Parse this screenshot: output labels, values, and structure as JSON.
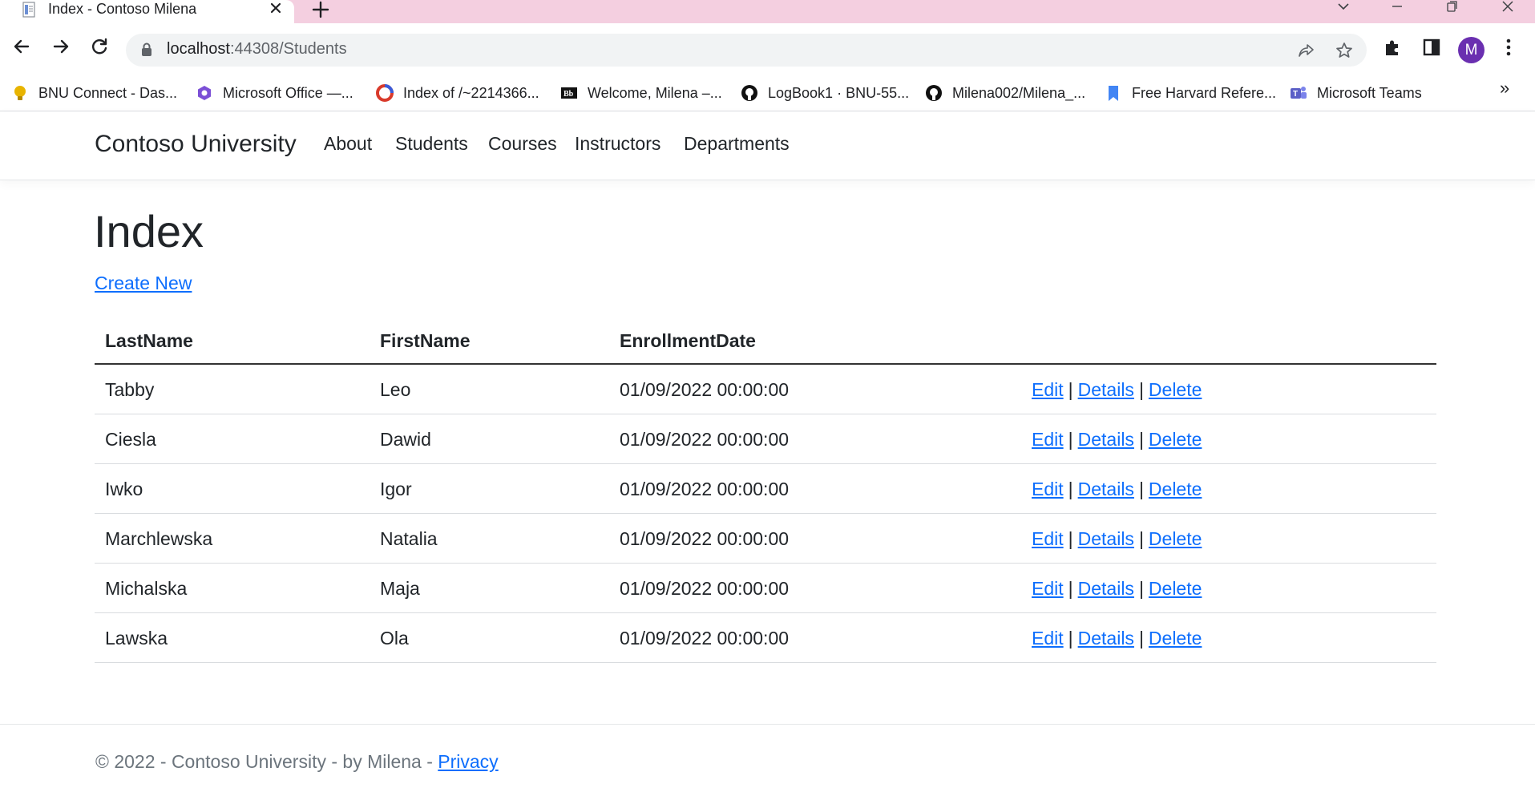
{
  "browser": {
    "tab_title": "Index - Contoso Milena",
    "url_host": "localhost",
    "url_path": ":44308/Students",
    "avatar_letter": "M",
    "accent_tabstrip": "#f4cfe0",
    "bookmarks": [
      {
        "label": "BNU Connect - Das...",
        "icon": "bulb-icon",
        "color": "#e8b400"
      },
      {
        "label": "Microsoft Office —...",
        "icon": "office-icon",
        "color": "#7b4fd6"
      },
      {
        "label": "Index of /~2214366...",
        "icon": "circle-logo-icon",
        "color": "#d93a2b"
      },
      {
        "label": "Welcome, Milena –...",
        "icon": "blackboard-icon",
        "color": "#000000"
      },
      {
        "label": "LogBook1 · BNU-55...",
        "icon": "github-icon",
        "color": "#111111"
      },
      {
        "label": "Milena002/Milena_...",
        "icon": "github-icon",
        "color": "#111111"
      },
      {
        "label": "Free Harvard Refere...",
        "icon": "bookmark-icon",
        "color": "#4285f4"
      },
      {
        "label": "Microsoft Teams",
        "icon": "teams-icon",
        "color": "#5b5fc7"
      }
    ],
    "bookmarks_overflow": "»"
  },
  "site": {
    "brand": "Contoso University",
    "nav": [
      "About",
      "Students",
      "Courses",
      "Instructors",
      "Departments"
    ]
  },
  "main": {
    "title": "Index",
    "create_link": "Create New",
    "columns": [
      "LastName",
      "FirstName",
      "EnrollmentDate"
    ],
    "actions": {
      "edit": "Edit",
      "details": "Details",
      "delete": "Delete",
      "separator": "|"
    },
    "rows": [
      {
        "last": "Tabby",
        "first": "Leo",
        "date": "01/09/2022 00:00:00"
      },
      {
        "last": "Ciesla",
        "first": "Dawid",
        "date": "01/09/2022 00:00:00"
      },
      {
        "last": "Iwko",
        "first": "Igor",
        "date": "01/09/2022 00:00:00"
      },
      {
        "last": "Marchlewska",
        "first": "Natalia",
        "date": "01/09/2022 00:00:00"
      },
      {
        "last": "Michalska",
        "first": "Maja",
        "date": "01/09/2022 00:00:00"
      },
      {
        "last": "Lawska",
        "first": "Ola",
        "date": "01/09/2022 00:00:00"
      }
    ]
  },
  "footer": {
    "text": "© 2022 - Contoso University - by Milena - ",
    "privacy": "Privacy"
  }
}
